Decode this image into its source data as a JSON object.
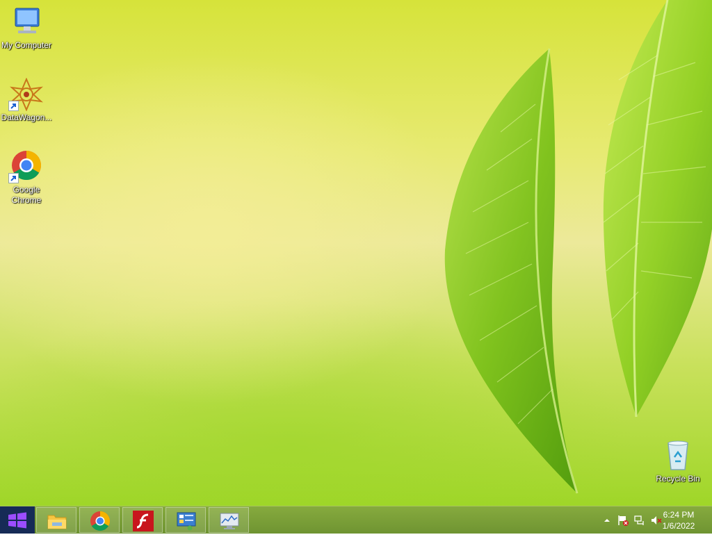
{
  "desktop": {
    "icons": [
      {
        "label": "My Computer",
        "icon": "my-computer-icon"
      },
      {
        "label": "DataWagon...",
        "icon": "datawagon-icon"
      },
      {
        "label": "Google Chrome",
        "icon": "chrome-icon"
      },
      {
        "label": "Recycle Bin",
        "icon": "recycle-bin-icon"
      }
    ]
  },
  "taskbar": {
    "pinned": [
      {
        "name": "file-explorer",
        "icon": "folder-icon"
      },
      {
        "name": "google-chrome",
        "icon": "chrome-icon"
      },
      {
        "name": "adobe-flash",
        "icon": "flash-icon"
      },
      {
        "name": "control-panel",
        "icon": "control-panel-icon"
      },
      {
        "name": "performance-monitor",
        "icon": "monitor-chart-icon"
      }
    ],
    "tray": {
      "icons": [
        "show-hidden-icons-arrow",
        "action-center-flag-icon",
        "network-icon",
        "volume-muted-icon"
      ],
      "time": "6:24 PM",
      "date": "1/6/2022"
    }
  },
  "colors": {
    "start_button": "#162b56",
    "taskbar": "#7a9f38"
  }
}
